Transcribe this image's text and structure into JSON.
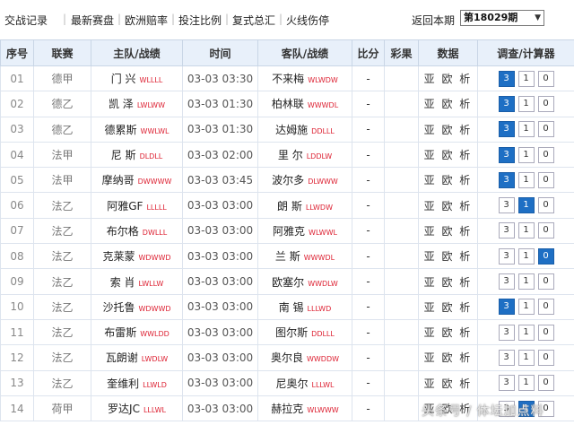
{
  "nav": {
    "items": [
      "交战记录",
      "最新赛盘",
      "欧洲赔率",
      "投注比例",
      "复式总汇",
      "火线伤停"
    ],
    "return_label": "返回本期",
    "period_value": "第18029期"
  },
  "table": {
    "headers": [
      "序号",
      "联赛",
      "主队/战绩",
      "时间",
      "客队/战绩",
      "比分",
      "彩果",
      "数据",
      "调查/计算器"
    ],
    "data_label": "亚 欧 析",
    "rows": [
      {
        "no": "01",
        "league": "德甲",
        "home": "门  兴",
        "home_form": "WLLLL",
        "time": "03-03 03:30",
        "away": "不来梅",
        "away_form": "WLWDW",
        "score": "-",
        "result": "",
        "b1": "3",
        "b2": "1",
        "b3": "0",
        "active": "1"
      },
      {
        "no": "02",
        "league": "德乙",
        "home": "凯  泽",
        "home_form": "LWLWW",
        "time": "03-03 01:30",
        "away": "柏林联",
        "away_form": "WWWDL",
        "score": "-",
        "result": "",
        "b1": "3",
        "b2": "1",
        "b3": "0",
        "active": "1"
      },
      {
        "no": "03",
        "league": "德乙",
        "home": "德累斯",
        "home_form": "WWLWL",
        "time": "03-03 01:30",
        "away": "达姆施",
        "away_form": "DDLLL",
        "score": "-",
        "result": "",
        "b1": "3",
        "b2": "1",
        "b3": "0",
        "active": "1"
      },
      {
        "no": "04",
        "league": "法甲",
        "home": "尼  斯",
        "home_form": "DLDLL",
        "time": "03-03 02:00",
        "away": "里  尔",
        "away_form": "LDDLW",
        "score": "-",
        "result": "",
        "b1": "3",
        "b2": "1",
        "b3": "0",
        "active": "1"
      },
      {
        "no": "05",
        "league": "法甲",
        "home": "摩纳哥",
        "home_form": "DWWWW",
        "time": "03-03 03:45",
        "away": "波尔多",
        "away_form": "DLWWW",
        "score": "-",
        "result": "",
        "b1": "3",
        "b2": "1",
        "b3": "0",
        "active": "1"
      },
      {
        "no": "06",
        "league": "法乙",
        "home": "阿雅GF",
        "home_form": "LLLLL",
        "time": "03-03 03:00",
        "away": "朗  斯",
        "away_form": "LLWDW",
        "score": "-",
        "result": "",
        "b1": "3",
        "b2": "1",
        "b3": "0",
        "active": "2"
      },
      {
        "no": "07",
        "league": "法乙",
        "home": "布尔格",
        "home_form": "DWLLL",
        "time": "03-03 03:00",
        "away": "阿雅克",
        "away_form": "WLWWL",
        "score": "-",
        "result": "",
        "b1": "3",
        "b2": "1",
        "b3": "0",
        "active": ""
      },
      {
        "no": "08",
        "league": "法乙",
        "home": "克莱蒙",
        "home_form": "WDWWD",
        "time": "03-03 03:00",
        "away": "兰  斯",
        "away_form": "WWWDL",
        "score": "-",
        "result": "",
        "b1": "3",
        "b2": "1",
        "b3": "0",
        "active": "3"
      },
      {
        "no": "09",
        "league": "法乙",
        "home": "索  肖",
        "home_form": "LWLLW",
        "time": "03-03 03:00",
        "away": "欧塞尔",
        "away_form": "WWDLW",
        "score": "-",
        "result": "",
        "b1": "3",
        "b2": "1",
        "b3": "0",
        "active": ""
      },
      {
        "no": "10",
        "league": "法乙",
        "home": "沙托鲁",
        "home_form": "WDWWD",
        "time": "03-03 03:00",
        "away": "南  锡",
        "away_form": "LLLWD",
        "score": "-",
        "result": "",
        "b1": "3",
        "b2": "1",
        "b3": "0",
        "active": "1"
      },
      {
        "no": "11",
        "league": "法乙",
        "home": "布雷斯",
        "home_form": "WWLDD",
        "time": "03-03 03:00",
        "away": "图尔斯",
        "away_form": "DDLLL",
        "score": "-",
        "result": "",
        "b1": "3",
        "b2": "1",
        "b3": "0",
        "active": ""
      },
      {
        "no": "12",
        "league": "法乙",
        "home": "瓦朗谢",
        "home_form": "LWDLW",
        "time": "03-03 03:00",
        "away": "奥尔良",
        "away_form": "WWDDW",
        "score": "-",
        "result": "",
        "b1": "3",
        "b2": "1",
        "b3": "0",
        "active": ""
      },
      {
        "no": "13",
        "league": "法乙",
        "home": "奎维利",
        "home_form": "LLWLD",
        "time": "03-03 03:00",
        "away": "尼奥尔",
        "away_form": "LLLWL",
        "score": "-",
        "result": "",
        "b1": "3",
        "b2": "1",
        "b3": "0",
        "active": ""
      },
      {
        "no": "14",
        "league": "荷甲",
        "home": "罗达JC",
        "home_form": "LLLWL",
        "time": "03-03 03:00",
        "away": "赫拉克",
        "away_form": "WLWWW",
        "score": "-",
        "result": "",
        "b1": "3",
        "b2": "1",
        "b3": "0",
        "active": "2"
      }
    ]
  },
  "watermark": "头条号 / 体坛加点料"
}
